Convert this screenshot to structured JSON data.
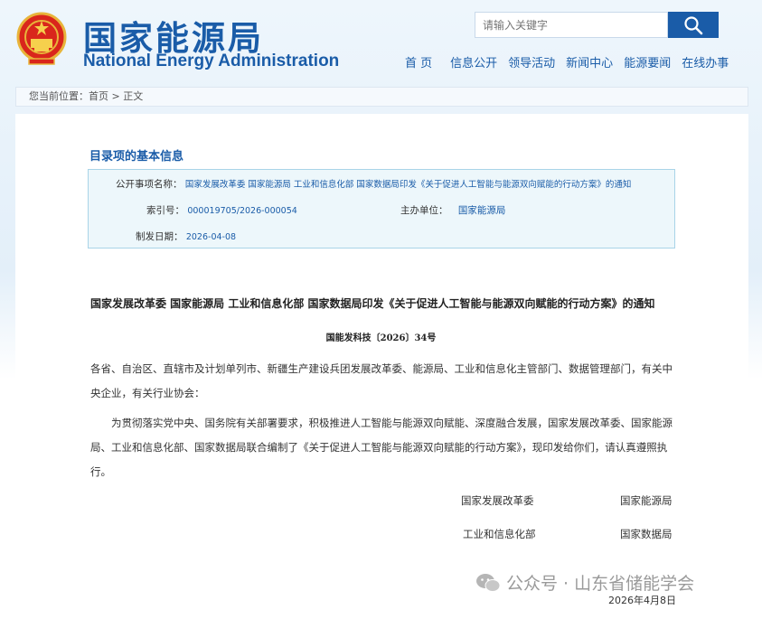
{
  "header": {
    "site_name_cn": "国家能源局",
    "site_name_en": "National Energy Administration",
    "search_placeholder": "请输入关键字",
    "nav": [
      "首 页",
      "信息公开",
      "领导活动",
      "新闻中心",
      "能源要闻",
      "在线办事"
    ]
  },
  "breadcrumb": {
    "label": "您当前位置：",
    "home": "首页",
    "sep": " > ",
    "current": "正文"
  },
  "meta": {
    "section_title": "目录项的基本信息",
    "subject_label": "公开事项名称：",
    "subject_value": "国家发展改革委 国家能源局 工业和信息化部 国家数据局印发《关于促进人工智能与能源双向赋能的行动方案》的通知",
    "index_label": "索引号：",
    "index_value": "000019705/2026-000054",
    "host_label": "主办单位：",
    "host_value": "国家能源局",
    "date_label": "制发日期：",
    "date_value": "2026-04-08"
  },
  "document": {
    "title": "国家发展改革委 国家能源局 工业和信息化部 国家数据局印发《关于促进人工智能与能源双向赋能的行动方案》的通知",
    "number": "国能发科技〔2026〕34号",
    "recipients_line1": "各省、自治区、直辖市及计划单列市、新疆生产建设兵团发展改革委、能源局、工业和信息化主管部门、数据管理部门，有关中",
    "recipients_line2": "央企业，有关行业协会：",
    "body_line1": "为贯彻落实党中央、国务院有关部署要求，积极推进人工智能与能源双向赋能、深度融合发展，国家发展改革委、国家能源",
    "body_line2": "局、工业和信息化部、国家数据局联合编制了《关于促进人工智能与能源双向赋能的行动方案》，现印发给你们，请认真遵照执",
    "body_line3": "行。",
    "signers": [
      "国家发展改革委",
      "国家能源局",
      "工业和信息化部",
      "国家数据局"
    ],
    "sign_date": "2026年4月8日"
  },
  "watermark": {
    "text": "公众号 · 山东省储能学会"
  },
  "colors": {
    "brand_blue": "#1a5ca8",
    "meta_bg": "#edf7fb",
    "meta_border": "#a9d4e8"
  }
}
